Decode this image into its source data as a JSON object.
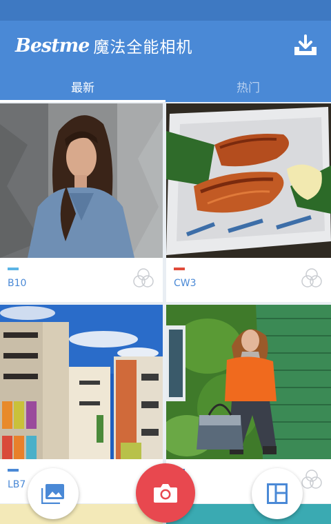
{
  "app": {
    "brand": "Bestme",
    "title_cn": "魔法全能相机"
  },
  "tabs": [
    {
      "label": "最新",
      "active": true
    },
    {
      "label": "热门",
      "active": false
    }
  ],
  "filters": [
    {
      "code": "B10",
      "swatch_color": "#5bb4e5"
    },
    {
      "code": "CW3",
      "swatch_color": "#e04b3a"
    },
    {
      "code": "LB7",
      "swatch_color": "#4a89d6"
    },
    {
      "code": "",
      "swatch_color": "#4a89d6"
    }
  ],
  "icons": {
    "download": "download-icon",
    "blend": "blend-circles-icon",
    "gallery": "gallery-icon",
    "camera": "camera-icon",
    "collage": "collage-layout-icon"
  },
  "colors": {
    "header": "#4a89d6",
    "statusbar": "#3e79c2",
    "accent": "#4a89d6",
    "camera_button": "#e8484f"
  }
}
